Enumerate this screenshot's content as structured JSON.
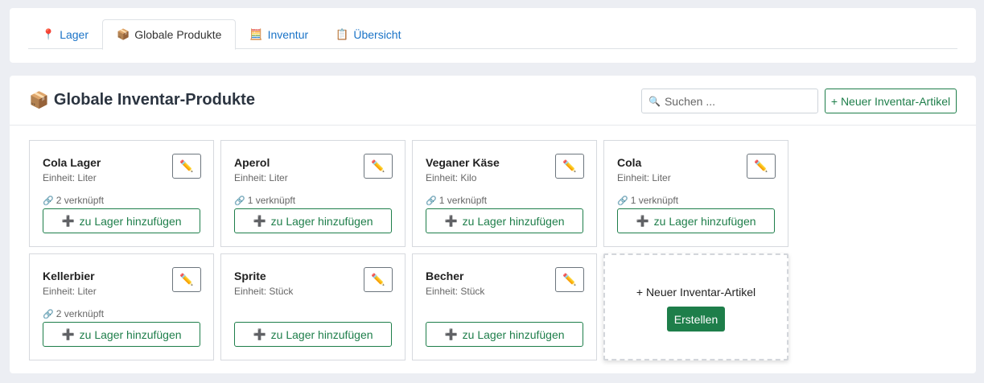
{
  "tabs": [
    {
      "icon": "pin-icon",
      "glyph": "📍",
      "label": "Lager",
      "active": false
    },
    {
      "icon": "package-icon",
      "glyph": "📦",
      "label": "Globale Produkte",
      "active": true
    },
    {
      "icon": "abacus-icon",
      "glyph": "🧮",
      "label": "Inventur",
      "active": false
    },
    {
      "icon": "clipboard-icon",
      "glyph": "📋",
      "label": "Übersicht",
      "active": false
    }
  ],
  "header": {
    "icon_glyph": "📦",
    "title": "Globale Inventar-Produkte",
    "search_placeholder": "Suchen ...",
    "search_value": "",
    "new_button_label": "+ Neuer Inventar-Artikel"
  },
  "products": [
    {
      "name": "Cola Lager",
      "unit": "Einheit: Liter",
      "linked": "2 verknüpft",
      "add_label": "zu Lager hinzufügen"
    },
    {
      "name": "Aperol",
      "unit": "Einheit: Liter",
      "linked": "1 verknüpft",
      "add_label": "zu Lager hinzufügen"
    },
    {
      "name": "Veganer Käse",
      "unit": "Einheit: Kilo",
      "linked": "1 verknüpft",
      "add_label": "zu Lager hinzufügen"
    },
    {
      "name": "Cola",
      "unit": "Einheit: Liter",
      "linked": "1 verknüpft",
      "add_label": "zu Lager hinzufügen"
    },
    {
      "name": "Kellerbier",
      "unit": "Einheit: Liter",
      "linked": "2 verknüpft",
      "add_label": "zu Lager hinzufügen"
    },
    {
      "name": "Sprite",
      "unit": "Einheit: Stück",
      "linked": "",
      "add_label": "zu Lager hinzufügen"
    },
    {
      "name": "Becher",
      "unit": "Einheit: Stück",
      "linked": "",
      "add_label": "zu Lager hinzufügen"
    }
  ],
  "new_card": {
    "label": "+ Neuer Inventar-Artikel",
    "button_label": "Erstellen"
  },
  "colors": {
    "accent": "#1e7e4a",
    "link": "#1a73c7",
    "background": "#eceef3"
  }
}
